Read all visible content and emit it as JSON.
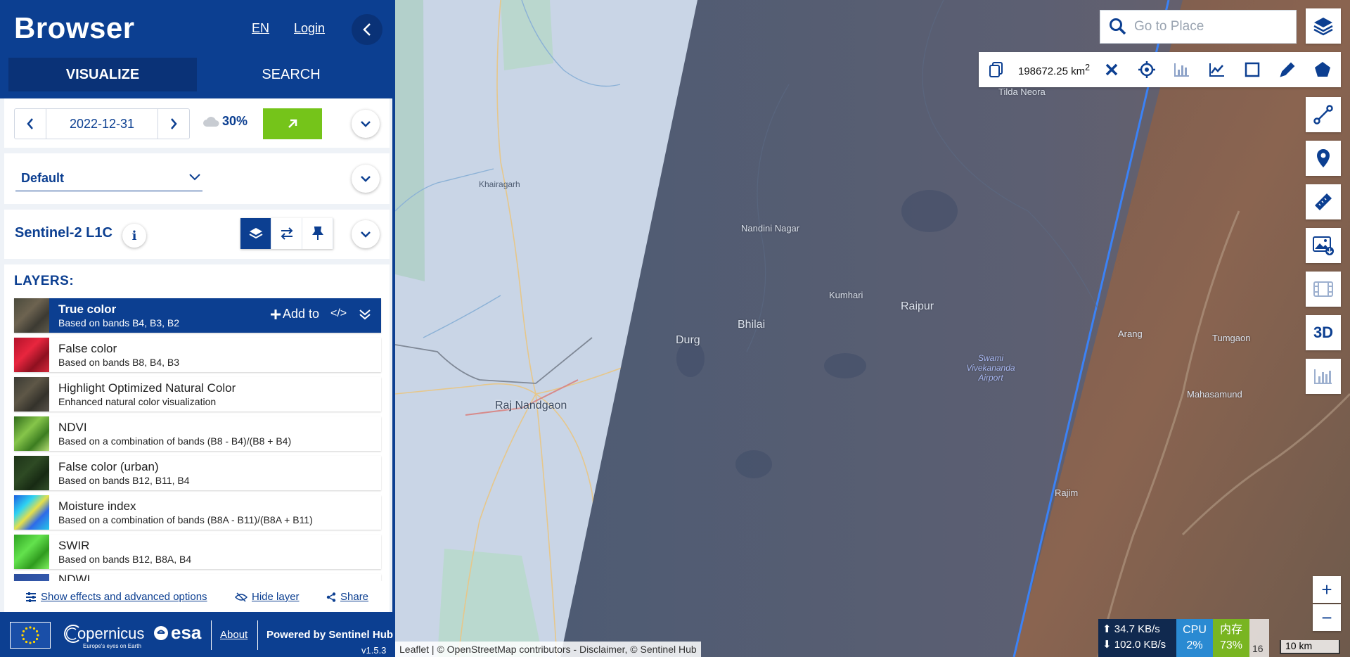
{
  "header": {
    "logo": "Browser",
    "lang": "EN",
    "login": "Login",
    "tabs": {
      "visualize": "VISUALIZE",
      "search": "SEARCH"
    }
  },
  "date_card": {
    "date": "2022-12-31",
    "cloud": "30%"
  },
  "theme": {
    "selected": "Default"
  },
  "collection": {
    "name": "Sentinel-2 L1C",
    "info": "i"
  },
  "layers": {
    "title": "LAYERS:",
    "add_to": "Add to",
    "items": [
      {
        "name": "True color",
        "desc": "Based on bands B4, B3, B2"
      },
      {
        "name": "False color",
        "desc": "Based on bands B8, B4, B3"
      },
      {
        "name": "Highlight Optimized Natural Color",
        "desc": "Enhanced natural color visualization"
      },
      {
        "name": "NDVI",
        "desc": "Based on a combination of bands (B8 - B4)/(B8 + B4)"
      },
      {
        "name": "False color (urban)",
        "desc": "Based on bands B12, B11, B4"
      },
      {
        "name": "Moisture index",
        "desc": "Based on a combination of bands (B8A - B11)/(B8A + B11)"
      },
      {
        "name": "SWIR",
        "desc": "Based on bands B12, B8A, B4"
      },
      {
        "name": "NDWI",
        "desc": ""
      }
    ]
  },
  "effects": {
    "show": "Show effects and advanced options",
    "hide": "Hide layer",
    "share": "Share"
  },
  "footer": {
    "about": "About",
    "powered": "Powered by Sentinel Hub",
    "version": "v1.5.3",
    "copernicus": "opernicus",
    "copernicus_tag": "Europe's eyes on Earth",
    "esa": "esa"
  },
  "map": {
    "search_placeholder": "Go to Place",
    "aoi_area": "198672.25 km",
    "aoi_unit_sup": "2",
    "labels": [
      {
        "text": "Khairagarh"
      },
      {
        "text": "Nandini Nagar"
      },
      {
        "text": "Kumhari"
      },
      {
        "text": "Raipur"
      },
      {
        "text": "Bhilai"
      },
      {
        "text": "Durg"
      },
      {
        "text": "Raj Nandgaon"
      },
      {
        "text": "Swami Vivekananda Airport"
      },
      {
        "text": "Arang"
      },
      {
        "text": "Tumgaon"
      },
      {
        "text": "Mahasamund"
      },
      {
        "text": "Rajim"
      },
      {
        "text": "Tilda Neora"
      }
    ],
    "btn_3d": "3D",
    "zoom_in": "+",
    "zoom_out": "−",
    "attribution": "Leaflet | © OpenStreetMap contributors - Disclaimer, © Sentinel Hub",
    "scale": "10 km"
  },
  "netmon": {
    "up": "34.7 KB/s",
    "down": "102.0 KB/s",
    "cpu_label": "CPU",
    "cpu": "2%",
    "mem_label": "内存",
    "mem": "73%",
    "extra": "16"
  }
}
